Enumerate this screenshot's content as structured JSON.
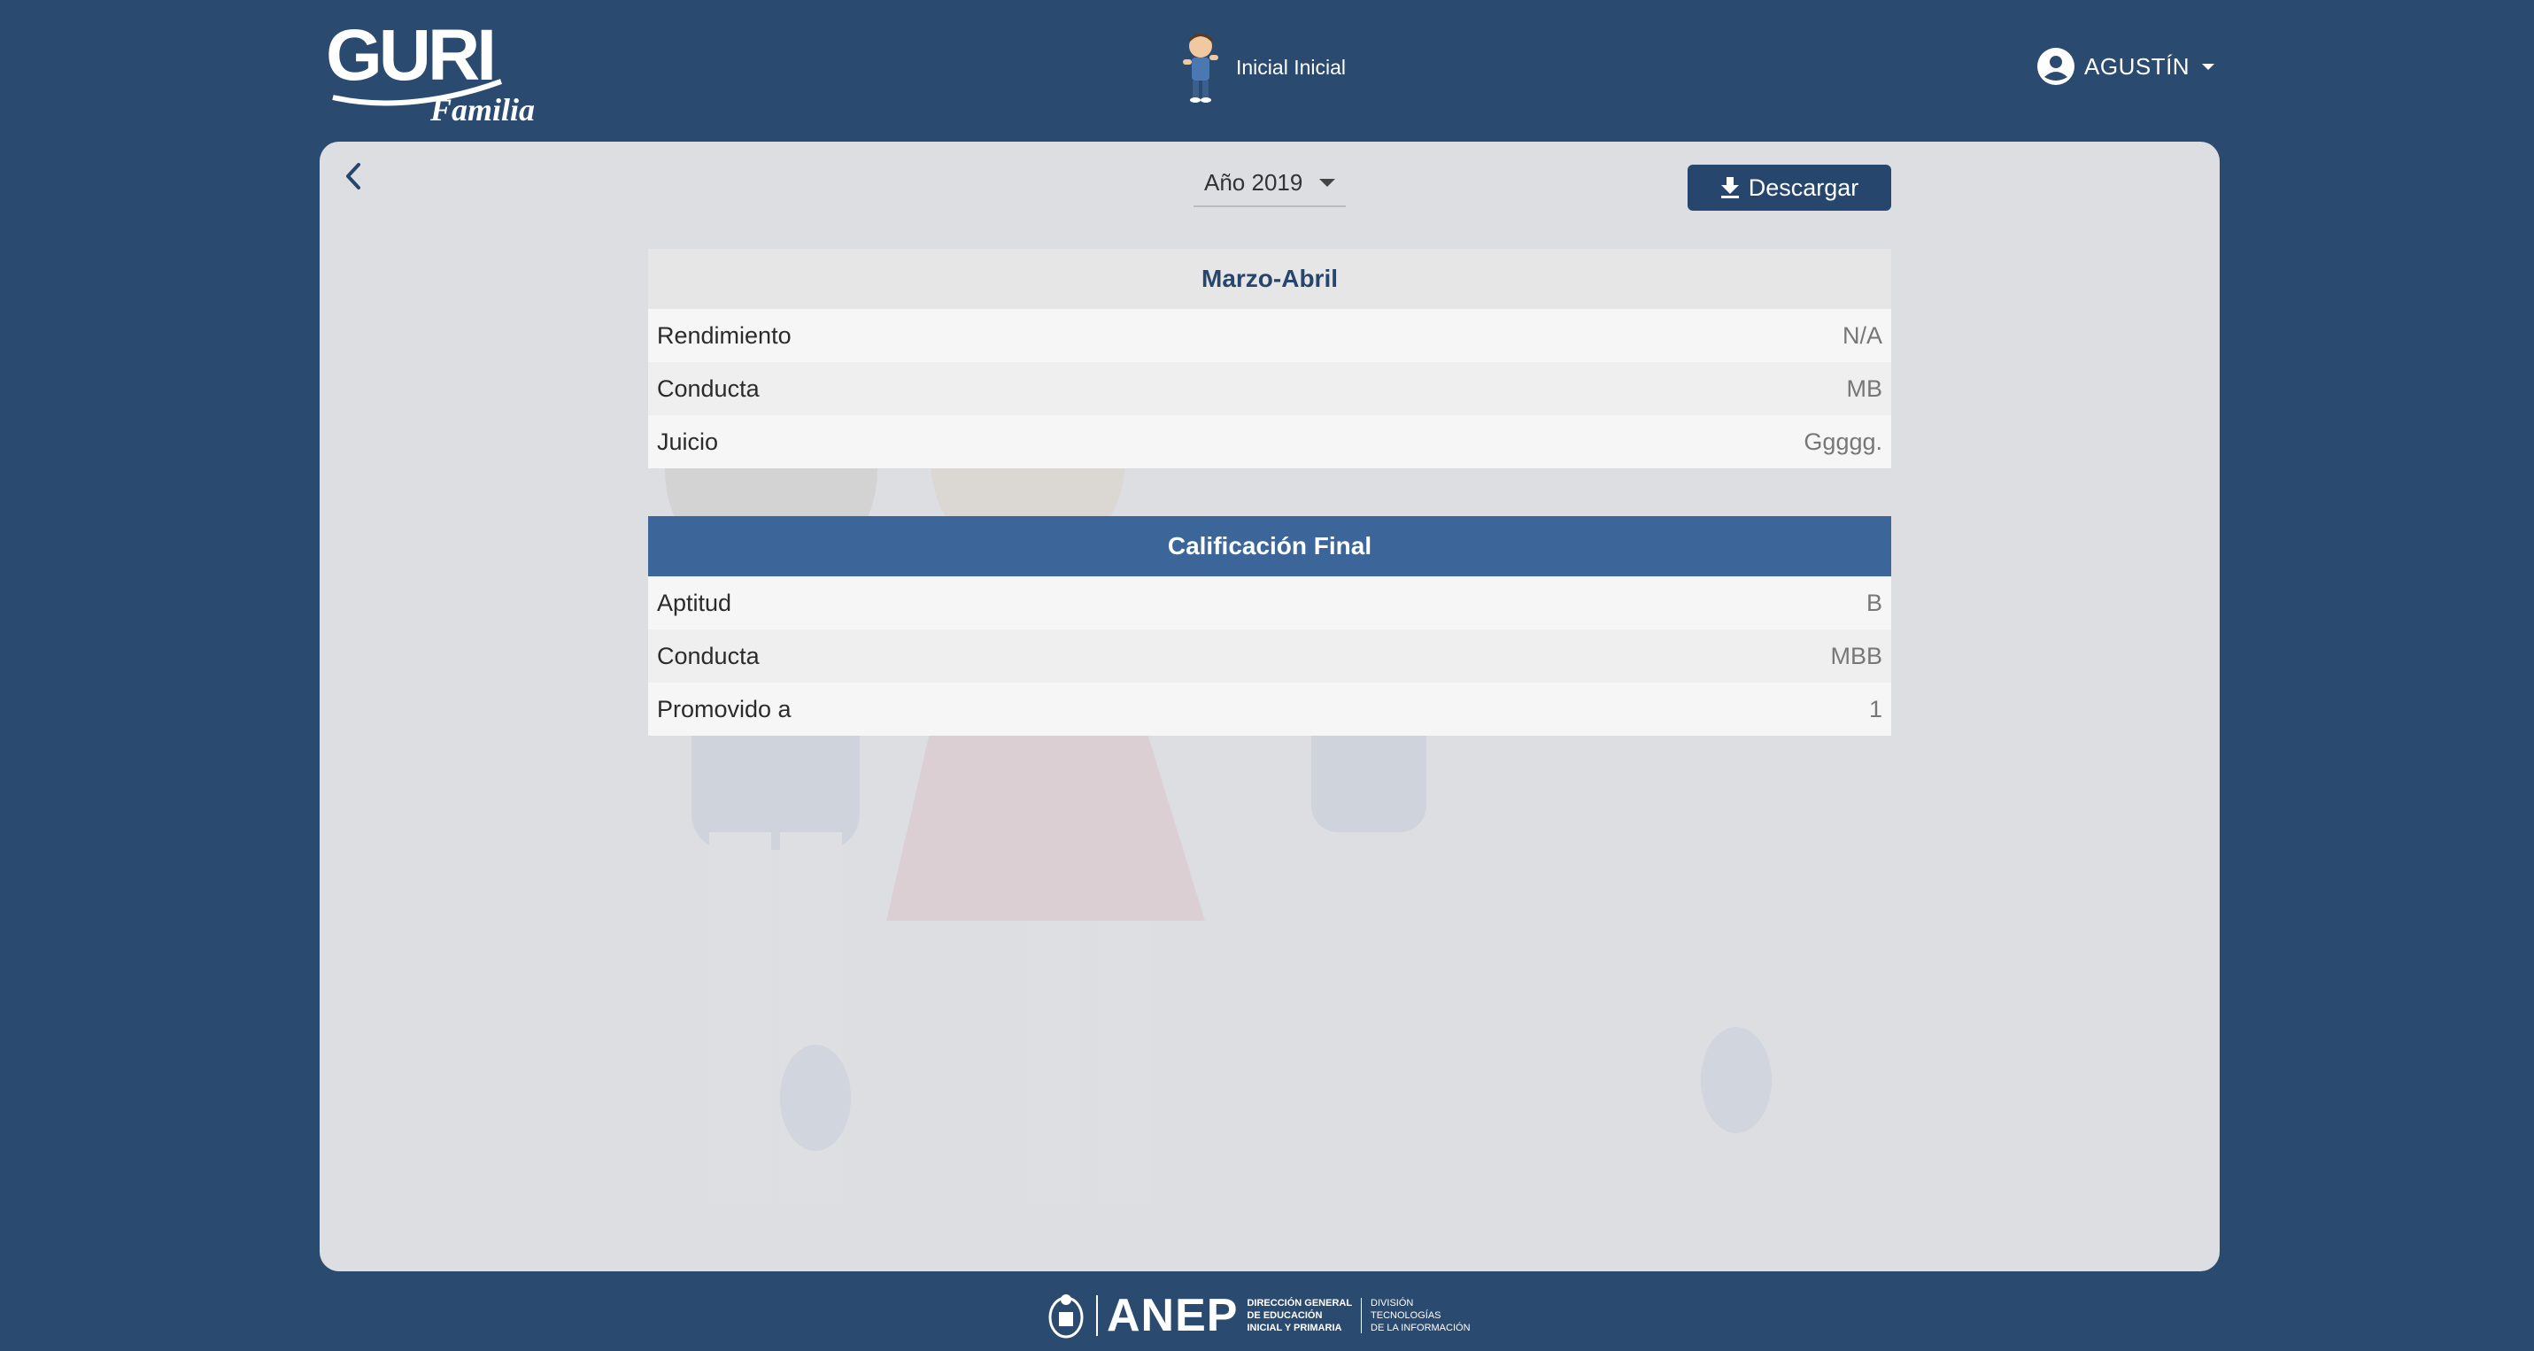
{
  "header": {
    "logo_main": "GURI",
    "logo_sub": "Familia",
    "student_name": "Inicial Inicial",
    "user_name": "AGUSTÍN"
  },
  "toolbar": {
    "year_label": "Año 2019",
    "download_label": "Descargar"
  },
  "icons": {
    "back": "chevron-left-icon",
    "download": "download-icon",
    "account": "account-circle-icon",
    "caret": "caret-down-icon"
  },
  "period": {
    "title": "Marzo-Abril",
    "rows": [
      {
        "label": "Rendimiento",
        "value": "N/A"
      },
      {
        "label": "Conducta",
        "value": "MB"
      },
      {
        "label": "Juicio",
        "value": "Ggggg."
      }
    ]
  },
  "final": {
    "title": "Calificación Final",
    "rows": [
      {
        "label": "Aptitud",
        "value": "B"
      },
      {
        "label": "Conducta",
        "value": "MBB"
      },
      {
        "label": "Promovido a",
        "value": "1"
      }
    ]
  },
  "footer": {
    "brand": "ANEP",
    "org_line1": "DIRECCIÓN GENERAL",
    "org_line2": "DE EDUCACIÓN",
    "org_line3": "INICIAL Y PRIMARIA",
    "div_line1": "DIVISIÓN",
    "div_line2": "TECNOLOGÍAS",
    "div_line3": "DE LA INFORMACIÓN"
  },
  "colors": {
    "background": "#2a4a6f",
    "card": "#dcdee2",
    "accent": "#27466e",
    "final_header": "#3c6699"
  }
}
